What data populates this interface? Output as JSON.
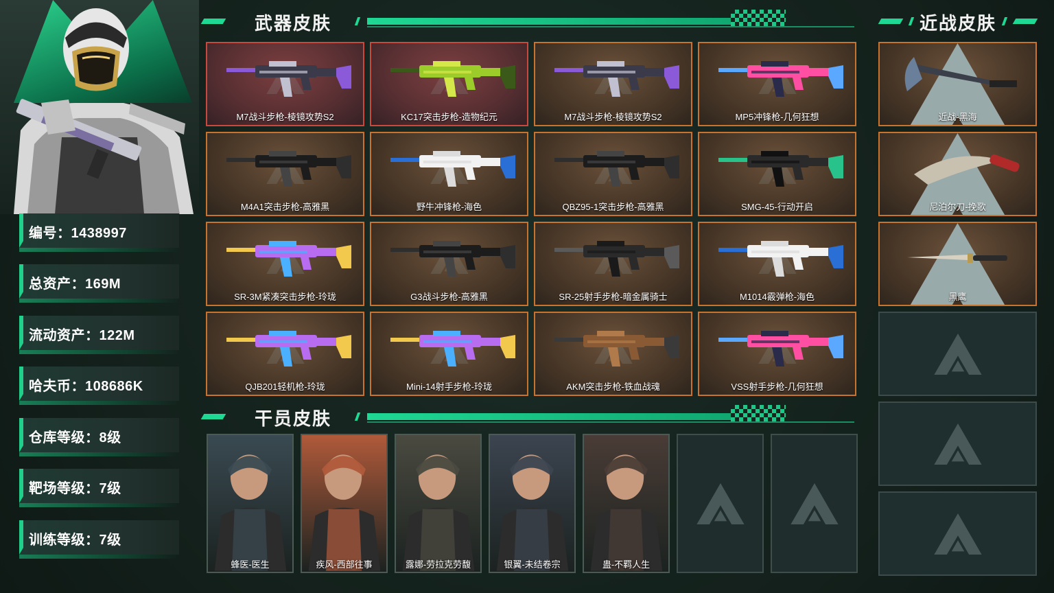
{
  "player": {
    "id_label": "编号：1438997",
    "total_assets": "总资产：169M",
    "liquid_assets": "流动资产：122M",
    "hafu_coin": "哈夫币：108686K",
    "warehouse_level": "仓库等级：8级",
    "range_level": "靶场等级：7级",
    "training_level": "训练等级：7级"
  },
  "sections": {
    "weapon_title": "武器皮肤",
    "melee_title": "近战皮肤",
    "operator_title": "干员皮肤"
  },
  "weapons": [
    {
      "label": "M7战斗步枪-棱镜攻势S2",
      "rarity": "red",
      "palette": [
        "#3a3a4a",
        "#8a5ad8",
        "#c0c0d0"
      ]
    },
    {
      "label": "KC17突击步枪-造物纪元",
      "rarity": "red",
      "palette": [
        "#9ccc2a",
        "#3b5a1a",
        "#d4e84a"
      ]
    },
    {
      "label": "M7战斗步枪-棱镜攻势S2",
      "rarity": "orange",
      "palette": [
        "#3a3a4a",
        "#8a5ad8",
        "#c0c0d0"
      ]
    },
    {
      "label": "MP5冲锋枪-几何狂想",
      "rarity": "orange",
      "palette": [
        "#ff4fa3",
        "#5aa8ff",
        "#2a2a4a"
      ]
    },
    {
      "label": "M4A1突击步枪-高雅黑",
      "rarity": "orange",
      "palette": [
        "#1c1c1c",
        "#2e2e2e",
        "#444444"
      ]
    },
    {
      "label": "野牛冲锋枪-海色",
      "rarity": "orange",
      "palette": [
        "#f2f2f2",
        "#2a6fd6",
        "#dcdcdc"
      ]
    },
    {
      "label": "QBZ95-1突击步枪-高雅黑",
      "rarity": "orange",
      "palette": [
        "#1c1c1c",
        "#2e2e2e",
        "#444444"
      ]
    },
    {
      "label": "SMG-45-行动开启",
      "rarity": "orange",
      "palette": [
        "#2a2a2a",
        "#27c38a",
        "#111111"
      ]
    },
    {
      "label": "SR-3M紧凑突击步枪-玲珑",
      "rarity": "orange",
      "palette": [
        "#b86cf0",
        "#f2c94c",
        "#4ab0ff"
      ]
    },
    {
      "label": "G3战斗步枪-高雅黑",
      "rarity": "orange",
      "palette": [
        "#1c1c1c",
        "#2e2e2e",
        "#444444"
      ]
    },
    {
      "label": "SR-25射手步枪-暗金属骑士",
      "rarity": "orange",
      "palette": [
        "#2a2a2a",
        "#5a5a5a",
        "#1a1a1a"
      ]
    },
    {
      "label": "M1014霰弹枪-海色",
      "rarity": "orange",
      "palette": [
        "#f2f2f2",
        "#2a6fd6",
        "#dcdcdc"
      ]
    },
    {
      "label": "QJB201轻机枪-玲珑",
      "rarity": "orange",
      "palette": [
        "#b86cf0",
        "#f2c94c",
        "#4ab0ff"
      ]
    },
    {
      "label": "Mini-14射手步枪-玲珑",
      "rarity": "orange",
      "palette": [
        "#b86cf0",
        "#f2c94c",
        "#4ab0ff"
      ]
    },
    {
      "label": "AKM突击步枪-铁血战魂",
      "rarity": "orange",
      "palette": [
        "#8a5a34",
        "#3a3a3a",
        "#b07a4a"
      ]
    },
    {
      "label": "VSS射手步枪-几何狂想",
      "rarity": "orange",
      "palette": [
        "#ff4fa3",
        "#5aa8ff",
        "#2a2a4a"
      ]
    }
  ],
  "melee": [
    {
      "label": "近战-黑海"
    },
    {
      "label": "尼泊尔刀-挽歌"
    },
    {
      "label": "黑鹰"
    }
  ],
  "operators": [
    {
      "label": "蜂医-医生",
      "tone": "#3a4a52"
    },
    {
      "label": "疾风-西部往事",
      "tone": "#b05a3a"
    },
    {
      "label": "露娜-劳拉克劳馥",
      "tone": "#4a4a40"
    },
    {
      "label": "银翼-未结卷宗",
      "tone": "#3c4450"
    },
    {
      "label": "蛊-不羁人生",
      "tone": "#4a3c36"
    }
  ]
}
